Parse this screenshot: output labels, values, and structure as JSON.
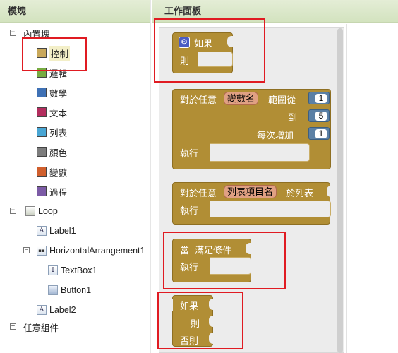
{
  "blocks_panel": {
    "title": "模塊",
    "builtin_label": "內置塊",
    "builtin_items": [
      {
        "label": "控制",
        "color": "#c9a85a"
      },
      {
        "label": "邏輯",
        "color": "#77ab41"
      },
      {
        "label": "數學",
        "color": "#3f71b5"
      },
      {
        "label": "文本",
        "color": "#b32d5e"
      },
      {
        "label": "列表",
        "color": "#49a6d4"
      },
      {
        "label": "顏色",
        "color": "#7d7d7d"
      },
      {
        "label": "變數",
        "color": "#d05f2d"
      },
      {
        "label": "過程",
        "color": "#7c5ba6"
      }
    ],
    "screen_label": "Loop",
    "components": [
      {
        "label": "Label1",
        "icon": "A"
      },
      {
        "label": "HorizontalArrangement1",
        "icon": "HA"
      },
      {
        "label": "TextBox1",
        "icon": "I"
      },
      {
        "label": "Button1",
        "icon": "btn"
      },
      {
        "label": "Label2",
        "icon": "A"
      }
    ],
    "any_component_label": "任意組件",
    "expander_minus": "−",
    "expander_plus": "+"
  },
  "workspace": {
    "title": "工作面板",
    "gear_glyph": "⚙",
    "if_block": {
      "if_label": "如果",
      "then_label": "則"
    },
    "for_range_block": {
      "prefix": "對於任意",
      "var_name": "變數名",
      "from_label": "範圍從",
      "from_value": "1",
      "to_label": "到",
      "to_value": "5",
      "step_label": "每次增加",
      "step_value": "1",
      "do_label": "執行"
    },
    "for_each_block": {
      "prefix": "對於任意",
      "item_name": "列表項目名",
      "in_list_label": "於列表",
      "do_label": "執行"
    },
    "while_block": {
      "while_label": "當",
      "cond_label": "滿足條件",
      "do_label": "執行"
    },
    "if_else_expr_block": {
      "if_label": "如果",
      "then_label": "則",
      "else_label": "否則"
    }
  },
  "colors": {
    "control_block": "#b18e35",
    "number_block": "#5b80a5",
    "variable_pill": "#e0a083",
    "highlight": "#e01b22"
  }
}
